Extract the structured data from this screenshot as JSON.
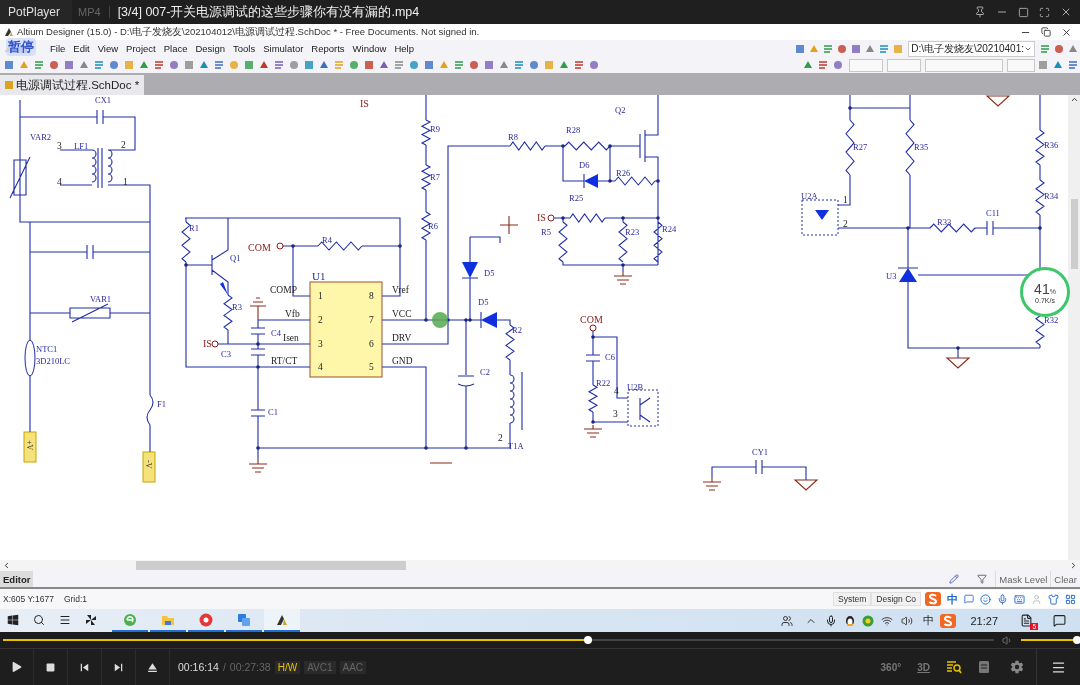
{
  "player": {
    "app": "PotPlayer",
    "format": "MP4",
    "title": "[3/4] 007-开关电源调试的这些步骤你有没有漏的.mp4"
  },
  "app_window": {
    "title": "Altium Designer (15.0) - D:\\电子发烧友\\202104012\\电源调试过程.SchDoc * - Free Documents. Not signed in.",
    "overlay": "暂停"
  },
  "menu": [
    "File",
    "Edit",
    "View",
    "Project",
    "Place",
    "Design",
    "Tools",
    "Simulator",
    "Reports",
    "Window",
    "Help"
  ],
  "path_box": "D:\\电子发烧友\\20210401:",
  "document_tabs": [
    {
      "label": "电源调试过程.SchDoc *",
      "selected": true
    }
  ],
  "schematic": {
    "labels": [
      {
        "text": "CX1",
        "kind": "part"
      },
      {
        "text": "IS",
        "kind": "net"
      },
      {
        "text": "Q2",
        "kind": "part"
      },
      {
        "text": "VAR2",
        "kind": "part"
      },
      {
        "text": "3",
        "kind": "pin"
      },
      {
        "text": "LF1",
        "kind": "part"
      },
      {
        "text": "2",
        "kind": "pin"
      },
      {
        "text": "R9",
        "kind": "part"
      },
      {
        "text": "R8",
        "kind": "part"
      },
      {
        "text": "R28",
        "kind": "part"
      },
      {
        "text": "R27",
        "kind": "part"
      },
      {
        "text": "R35",
        "kind": "part"
      },
      {
        "text": "R36",
        "kind": "part"
      },
      {
        "text": "D6",
        "kind": "part"
      },
      {
        "text": "R26",
        "kind": "part"
      },
      {
        "text": "4",
        "kind": "pin"
      },
      {
        "text": "1",
        "kind": "pin"
      },
      {
        "text": "R7",
        "kind": "part"
      },
      {
        "text": "R25",
        "kind": "part"
      },
      {
        "text": "U2A",
        "kind": "part"
      },
      {
        "text": "1",
        "kind": "pin"
      },
      {
        "text": "R34",
        "kind": "part"
      },
      {
        "text": "R1",
        "kind": "part"
      },
      {
        "text": "R6",
        "kind": "part"
      },
      {
        "text": "IS",
        "kind": "net"
      },
      {
        "text": "R5",
        "kind": "part"
      },
      {
        "text": "R23",
        "kind": "part"
      },
      {
        "text": "R24",
        "kind": "part"
      },
      {
        "text": "2",
        "kind": "pin"
      },
      {
        "text": "R33",
        "kind": "part"
      },
      {
        "text": "C11",
        "kind": "part"
      },
      {
        "text": "COM",
        "kind": "net"
      },
      {
        "text": "R4",
        "kind": "part"
      },
      {
        "text": "Q1",
        "kind": "part"
      },
      {
        "text": "U1",
        "kind": "chip"
      },
      {
        "text": "D5",
        "kind": "part"
      },
      {
        "text": "U3",
        "kind": "part"
      },
      {
        "text": "COMP",
        "kind": "pin"
      },
      {
        "text": "1",
        "kind": "pin"
      },
      {
        "text": "8",
        "kind": "pin"
      },
      {
        "text": "Vref",
        "kind": "pin"
      },
      {
        "text": "VAR1",
        "kind": "part"
      },
      {
        "text": "R3",
        "kind": "part"
      },
      {
        "text": "D5",
        "kind": "part"
      },
      {
        "text": "Vfb",
        "kind": "pin"
      },
      {
        "text": "2",
        "kind": "pin"
      },
      {
        "text": "7",
        "kind": "pin"
      },
      {
        "text": "VCC",
        "kind": "pin"
      },
      {
        "text": "COM",
        "kind": "net"
      },
      {
        "text": "C4",
        "kind": "part"
      },
      {
        "text": "R2",
        "kind": "part"
      },
      {
        "text": "R32",
        "kind": "part"
      },
      {
        "text": "NTC1",
        "kind": "part"
      },
      {
        "text": "IS",
        "kind": "net"
      },
      {
        "text": "Isen",
        "kind": "pin"
      },
      {
        "text": "3",
        "kind": "pin"
      },
      {
        "text": "6",
        "kind": "pin"
      },
      {
        "text": "DRV",
        "kind": "pin"
      },
      {
        "text": "3D210LC",
        "kind": "part"
      },
      {
        "text": "C3",
        "kind": "part"
      },
      {
        "text": "RT/CT",
        "kind": "pin"
      },
      {
        "text": "4",
        "kind": "pin"
      },
      {
        "text": "5",
        "kind": "pin"
      },
      {
        "text": "GND",
        "kind": "pin"
      },
      {
        "text": "C6",
        "kind": "part"
      },
      {
        "text": "C2",
        "kind": "part"
      },
      {
        "text": "R22",
        "kind": "part"
      },
      {
        "text": "4",
        "kind": "pin"
      },
      {
        "text": "U2B",
        "kind": "part"
      },
      {
        "text": "F1",
        "kind": "part"
      },
      {
        "text": "C1",
        "kind": "part"
      },
      {
        "text": "3",
        "kind": "pin"
      },
      {
        "text": "+V",
        "kind": "port"
      },
      {
        "text": "2",
        "kind": "pin"
      },
      {
        "text": "T1A",
        "kind": "part"
      },
      {
        "text": "CY1",
        "kind": "part"
      },
      {
        "text": "-V",
        "kind": "port"
      }
    ]
  },
  "monitor": {
    "percent": "41",
    "unit": "%",
    "speed": "0.7K/s"
  },
  "panel_tabs": [
    {
      "label": "Editor",
      "selected": true
    }
  ],
  "panel_buttons": [
    "Mask Level",
    "Clear"
  ],
  "status": {
    "coords": "X:605 Y:1677",
    "grid": "Grid:1",
    "tabs": [
      "System",
      "Design Co"
    ]
  },
  "ime": {
    "mode": "中"
  },
  "taskbar": {
    "apps": [
      {
        "kind": "browser",
        "selected": false
      },
      {
        "kind": "folder",
        "selected": false
      },
      {
        "kind": "video",
        "selected": false
      },
      {
        "kind": "chat",
        "selected": false
      },
      {
        "kind": "designer",
        "selected": true
      }
    ],
    "tray_lang": "中",
    "clock": "21:27",
    "badge": "5"
  },
  "playback": {
    "level": 0.59,
    "volume": {
      "level": 1.0
    },
    "position": "00:16:14",
    "separator": "/",
    "duration": "00:27:38",
    "tags": [
      {
        "label": "H/W",
        "active": true
      },
      {
        "label": "AVC1",
        "active": false
      },
      {
        "label": "AAC",
        "active": false
      }
    ],
    "view_labels": [
      "360°",
      "3D"
    ]
  }
}
